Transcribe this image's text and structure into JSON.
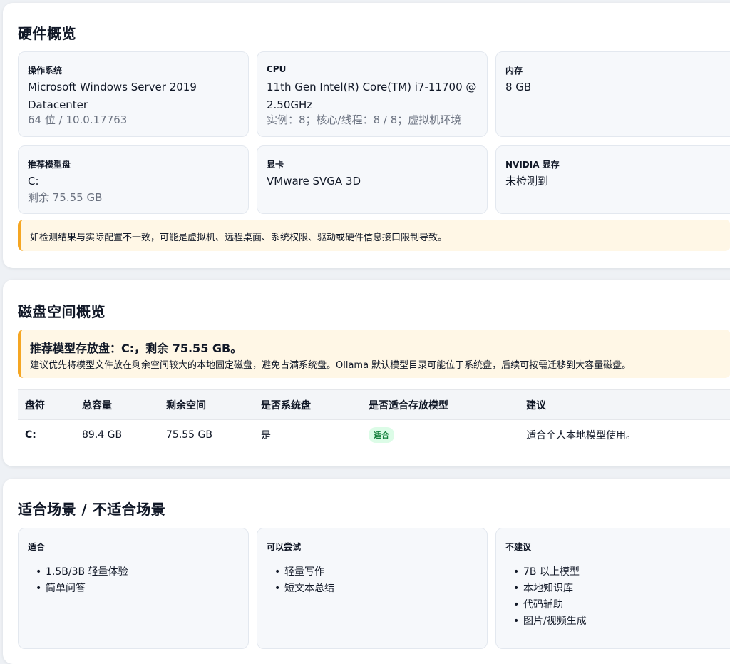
{
  "hardware": {
    "title": "硬件概览",
    "cards": {
      "os": {
        "label": "操作系统",
        "value": "Microsoft Windows Server 2019 Datacenter",
        "sub": "64 位 / 10.0.17763"
      },
      "cpu": {
        "label": "CPU",
        "value": "11th Gen Intel(R) Core(TM) i7-11700 @ 2.50GHz",
        "sub": "实例：8；核心/线程：8 / 8；虚拟机环境"
      },
      "mem": {
        "label": "内存",
        "value": "8 GB"
      },
      "disk": {
        "label": "推荐模型盘",
        "value": "C:",
        "sub": "剩余 75.55 GB"
      },
      "gpu": {
        "label": "显卡",
        "value": "VMware SVGA 3D"
      },
      "vram": {
        "label": "NVIDIA 显存",
        "value": "未检测到"
      }
    },
    "notice": "如检测结果与实际配置不一致，可能是虚拟机、远程桌面、系统权限、驱动或硬件信息接口限制导致。"
  },
  "disk_overview": {
    "title": "磁盘空间概览",
    "highlight": "推荐模型存放盘：C:，剩余 75.55 GB。",
    "advice": "建议优先将模型文件放在剩余空间较大的本地固定磁盘，避免占满系统盘。Ollama 默认模型目录可能位于系统盘，后续可按需迁移到大容量磁盘。",
    "columns": [
      "盘符",
      "总容量",
      "剩余空间",
      "是否系统盘",
      "是否适合存放模型",
      "建议"
    ],
    "rows": [
      {
        "drive": "C:",
        "total": "89.4 GB",
        "free": "75.55 GB",
        "system": "是",
        "fit": "适合",
        "advice": "适合个人本地模型使用。"
      }
    ]
  },
  "scenarios": {
    "title": "适合场景 / 不适合场景",
    "good": {
      "label": "适合",
      "items": [
        "1.5B/3B 轻量体验",
        "简单问答"
      ]
    },
    "try": {
      "label": "可以尝试",
      "items": [
        "轻量写作",
        "短文本总结"
      ]
    },
    "bad": {
      "label": "不建议",
      "items": [
        "7B 以上模型",
        "本地知识库",
        "代码辅助",
        "图片/视频生成"
      ]
    }
  },
  "colors": {
    "accent_warning": "#f5a623",
    "badge_green": "#15803d"
  }
}
